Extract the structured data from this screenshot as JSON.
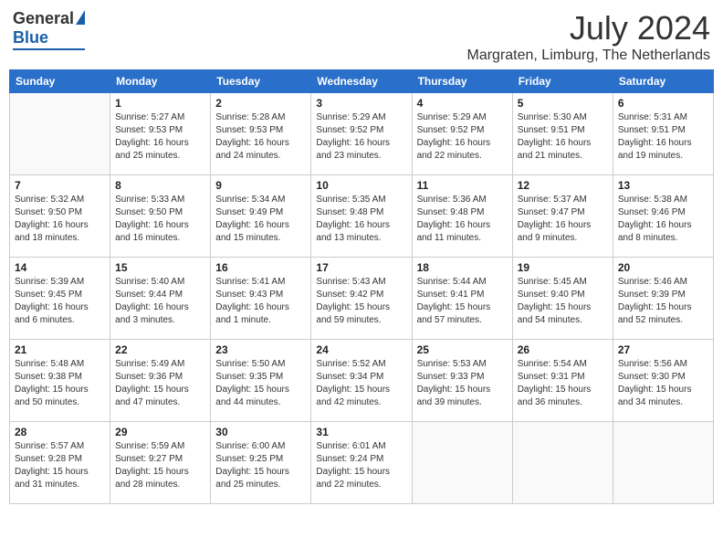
{
  "header": {
    "logo_general": "General",
    "logo_blue": "Blue",
    "month_year": "July 2024",
    "location": "Margraten, Limburg, The Netherlands"
  },
  "days_of_week": [
    "Sunday",
    "Monday",
    "Tuesday",
    "Wednesday",
    "Thursday",
    "Friday",
    "Saturday"
  ],
  "weeks": [
    [
      {
        "day": "",
        "sunrise": "",
        "sunset": "",
        "daylight": ""
      },
      {
        "day": "1",
        "sunrise": "Sunrise: 5:27 AM",
        "sunset": "Sunset: 9:53 PM",
        "daylight": "Daylight: 16 hours and 25 minutes."
      },
      {
        "day": "2",
        "sunrise": "Sunrise: 5:28 AM",
        "sunset": "Sunset: 9:53 PM",
        "daylight": "Daylight: 16 hours and 24 minutes."
      },
      {
        "day": "3",
        "sunrise": "Sunrise: 5:29 AM",
        "sunset": "Sunset: 9:52 PM",
        "daylight": "Daylight: 16 hours and 23 minutes."
      },
      {
        "day": "4",
        "sunrise": "Sunrise: 5:29 AM",
        "sunset": "Sunset: 9:52 PM",
        "daylight": "Daylight: 16 hours and 22 minutes."
      },
      {
        "day": "5",
        "sunrise": "Sunrise: 5:30 AM",
        "sunset": "Sunset: 9:51 PM",
        "daylight": "Daylight: 16 hours and 21 minutes."
      },
      {
        "day": "6",
        "sunrise": "Sunrise: 5:31 AM",
        "sunset": "Sunset: 9:51 PM",
        "daylight": "Daylight: 16 hours and 19 minutes."
      }
    ],
    [
      {
        "day": "7",
        "sunrise": "Sunrise: 5:32 AM",
        "sunset": "Sunset: 9:50 PM",
        "daylight": "Daylight: 16 hours and 18 minutes."
      },
      {
        "day": "8",
        "sunrise": "Sunrise: 5:33 AM",
        "sunset": "Sunset: 9:50 PM",
        "daylight": "Daylight: 16 hours and 16 minutes."
      },
      {
        "day": "9",
        "sunrise": "Sunrise: 5:34 AM",
        "sunset": "Sunset: 9:49 PM",
        "daylight": "Daylight: 16 hours and 15 minutes."
      },
      {
        "day": "10",
        "sunrise": "Sunrise: 5:35 AM",
        "sunset": "Sunset: 9:48 PM",
        "daylight": "Daylight: 16 hours and 13 minutes."
      },
      {
        "day": "11",
        "sunrise": "Sunrise: 5:36 AM",
        "sunset": "Sunset: 9:48 PM",
        "daylight": "Daylight: 16 hours and 11 minutes."
      },
      {
        "day": "12",
        "sunrise": "Sunrise: 5:37 AM",
        "sunset": "Sunset: 9:47 PM",
        "daylight": "Daylight: 16 hours and 9 minutes."
      },
      {
        "day": "13",
        "sunrise": "Sunrise: 5:38 AM",
        "sunset": "Sunset: 9:46 PM",
        "daylight": "Daylight: 16 hours and 8 minutes."
      }
    ],
    [
      {
        "day": "14",
        "sunrise": "Sunrise: 5:39 AM",
        "sunset": "Sunset: 9:45 PM",
        "daylight": "Daylight: 16 hours and 6 minutes."
      },
      {
        "day": "15",
        "sunrise": "Sunrise: 5:40 AM",
        "sunset": "Sunset: 9:44 PM",
        "daylight": "Daylight: 16 hours and 3 minutes."
      },
      {
        "day": "16",
        "sunrise": "Sunrise: 5:41 AM",
        "sunset": "Sunset: 9:43 PM",
        "daylight": "Daylight: 16 hours and 1 minute."
      },
      {
        "day": "17",
        "sunrise": "Sunrise: 5:43 AM",
        "sunset": "Sunset: 9:42 PM",
        "daylight": "Daylight: 15 hours and 59 minutes."
      },
      {
        "day": "18",
        "sunrise": "Sunrise: 5:44 AM",
        "sunset": "Sunset: 9:41 PM",
        "daylight": "Daylight: 15 hours and 57 minutes."
      },
      {
        "day": "19",
        "sunrise": "Sunrise: 5:45 AM",
        "sunset": "Sunset: 9:40 PM",
        "daylight": "Daylight: 15 hours and 54 minutes."
      },
      {
        "day": "20",
        "sunrise": "Sunrise: 5:46 AM",
        "sunset": "Sunset: 9:39 PM",
        "daylight": "Daylight: 15 hours and 52 minutes."
      }
    ],
    [
      {
        "day": "21",
        "sunrise": "Sunrise: 5:48 AM",
        "sunset": "Sunset: 9:38 PM",
        "daylight": "Daylight: 15 hours and 50 minutes."
      },
      {
        "day": "22",
        "sunrise": "Sunrise: 5:49 AM",
        "sunset": "Sunset: 9:36 PM",
        "daylight": "Daylight: 15 hours and 47 minutes."
      },
      {
        "day": "23",
        "sunrise": "Sunrise: 5:50 AM",
        "sunset": "Sunset: 9:35 PM",
        "daylight": "Daylight: 15 hours and 44 minutes."
      },
      {
        "day": "24",
        "sunrise": "Sunrise: 5:52 AM",
        "sunset": "Sunset: 9:34 PM",
        "daylight": "Daylight: 15 hours and 42 minutes."
      },
      {
        "day": "25",
        "sunrise": "Sunrise: 5:53 AM",
        "sunset": "Sunset: 9:33 PM",
        "daylight": "Daylight: 15 hours and 39 minutes."
      },
      {
        "day": "26",
        "sunrise": "Sunrise: 5:54 AM",
        "sunset": "Sunset: 9:31 PM",
        "daylight": "Daylight: 15 hours and 36 minutes."
      },
      {
        "day": "27",
        "sunrise": "Sunrise: 5:56 AM",
        "sunset": "Sunset: 9:30 PM",
        "daylight": "Daylight: 15 hours and 34 minutes."
      }
    ],
    [
      {
        "day": "28",
        "sunrise": "Sunrise: 5:57 AM",
        "sunset": "Sunset: 9:28 PM",
        "daylight": "Daylight: 15 hours and 31 minutes."
      },
      {
        "day": "29",
        "sunrise": "Sunrise: 5:59 AM",
        "sunset": "Sunset: 9:27 PM",
        "daylight": "Daylight: 15 hours and 28 minutes."
      },
      {
        "day": "30",
        "sunrise": "Sunrise: 6:00 AM",
        "sunset": "Sunset: 9:25 PM",
        "daylight": "Daylight: 15 hours and 25 minutes."
      },
      {
        "day": "31",
        "sunrise": "Sunrise: 6:01 AM",
        "sunset": "Sunset: 9:24 PM",
        "daylight": "Daylight: 15 hours and 22 minutes."
      },
      {
        "day": "",
        "sunrise": "",
        "sunset": "",
        "daylight": ""
      },
      {
        "day": "",
        "sunrise": "",
        "sunset": "",
        "daylight": ""
      },
      {
        "day": "",
        "sunrise": "",
        "sunset": "",
        "daylight": ""
      }
    ]
  ]
}
